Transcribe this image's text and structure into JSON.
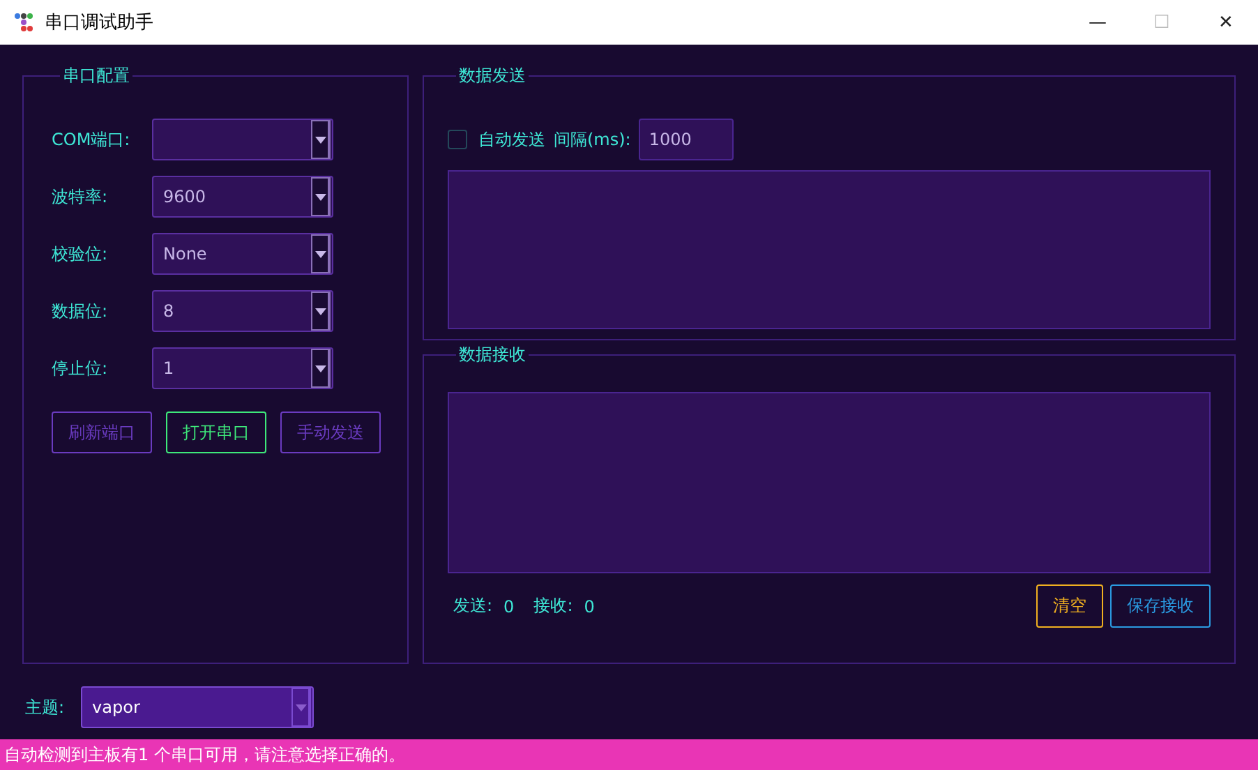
{
  "window": {
    "title": "串口调试助手",
    "controls": [
      "—",
      "☐",
      "✕"
    ]
  },
  "serial_config": {
    "title": "串口配置",
    "fields": [
      {
        "label": "COM端口:"
      },
      {
        "label": "波特率:",
        "value": "9600"
      },
      {
        "label": "校验位:",
        "value": "None"
      },
      {
        "label": "数据位:",
        "value": "8"
      },
      {
        "label": "停止位:",
        "value": "1"
      }
    ],
    "buttons": [
      {
        "label": "刷新端口",
        "disabled": true
      },
      {
        "label": "打开串口",
        "disabled": false
      },
      {
        "label": "手动发送",
        "disabled": true
      }
    ]
  },
  "send": {
    "title": "数据发送",
    "auto_send": {
      "label": "自动发送",
      "checked": false
    },
    "interval_label": "间隔(ms):",
    "interval": "1000"
  },
  "receive": {
    "title": "数据接收",
    "sent_label": "发送:",
    "sent": "0",
    "received_label": "接收:",
    "received": "0",
    "buttons": [
      {
        "label": "清空",
        "kind": "clear"
      },
      {
        "label": "保存接收",
        "kind": "save"
      }
    ]
  },
  "theme": {
    "label": "主题:",
    "value": "vapor"
  },
  "status_bar": "自动检测到主板有1 个串口可用，请注意选择正确的。"
}
